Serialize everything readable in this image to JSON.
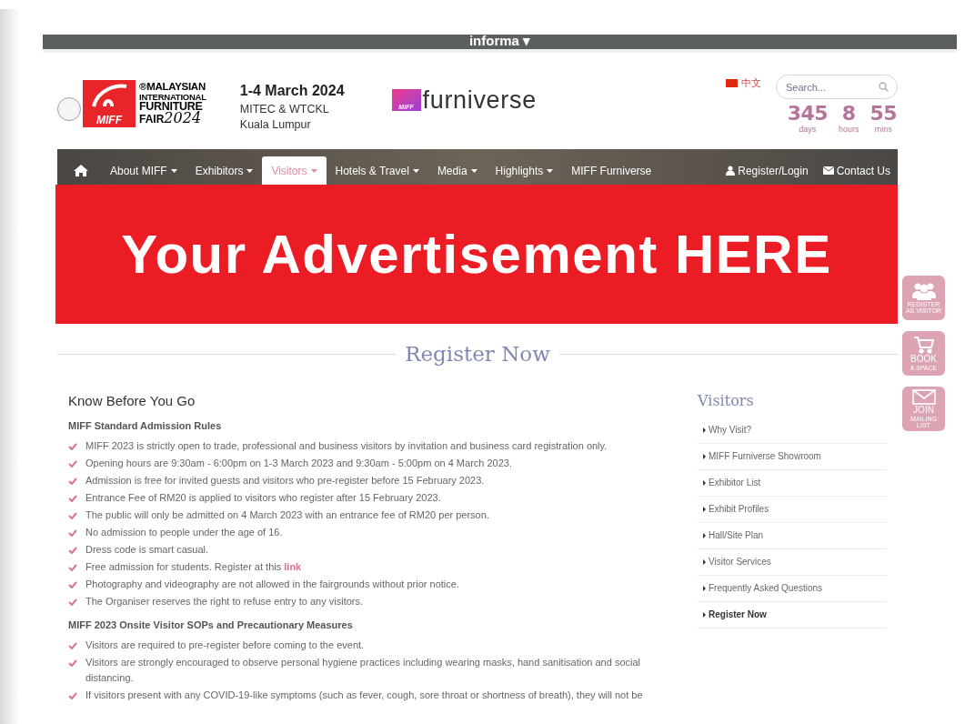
{
  "top_bar": {
    "brand": "informa ▾"
  },
  "header": {
    "logo": {
      "registered": "®",
      "lines": [
        "MALAYSIAN",
        "INTERNATIONAL",
        "FURNITURE"
      ],
      "fair": "FAIR",
      "year": "2024",
      "mark": "MIFF"
    },
    "event": {
      "date": "1-4 March 2024",
      "venue": "MITEC & WTCKL",
      "city": "Kuala Lumpur"
    },
    "partner_logo": {
      "mark": "MIFF",
      "text": "furniverse"
    },
    "language": "中文",
    "search": {
      "placeholder": "Search..."
    },
    "countdown": [
      {
        "value": "345",
        "unit": "days"
      },
      {
        "value": "8",
        "unit": "hours"
      },
      {
        "value": "55",
        "unit": "mins"
      }
    ]
  },
  "nav": {
    "items": [
      {
        "label": "About MIFF",
        "dropdown": true,
        "selected": false
      },
      {
        "label": "Exhibitors",
        "dropdown": true,
        "selected": false
      },
      {
        "label": "Visitors",
        "dropdown": true,
        "selected": true
      },
      {
        "label": "Hotels & Travel",
        "dropdown": true,
        "selected": false
      },
      {
        "label": "Media",
        "dropdown": true,
        "selected": false
      },
      {
        "label": "Highlights",
        "dropdown": true,
        "selected": false
      },
      {
        "label": "MIFF Furniverse",
        "dropdown": false,
        "selected": false
      }
    ],
    "right": [
      {
        "label": "Register/Login",
        "kind": "user"
      },
      {
        "label": "Contact Us",
        "kind": "mail"
      }
    ]
  },
  "banner": {
    "text": "Your Advertisement HERE"
  },
  "section_title": "Register Now",
  "content": {
    "title": "Know Before You Go",
    "groups": [
      {
        "heading": "MIFF Standard Admission Rules",
        "items": [
          {
            "text": "MIFF 2023 is strictly open to trade, professional and business visitors by invitation and business card registration only."
          },
          {
            "text": "Opening hours are 9:30am - 6:00pm on 1-3 March 2023 and 9:30am - 5:00pm on 4 March 2023."
          },
          {
            "text": "Admission is free for invited guests and visitors who pre-register before 15 February 2023."
          },
          {
            "text": "Entrance Fee of RM20 is applied to visitors who register after 15 February 2023."
          },
          {
            "text": "The public will only be admitted on 4 March 2023 with an entrance fee of RM20 per person."
          },
          {
            "text": "No admission to people under the age of 16."
          },
          {
            "text": "Dress code is smart casual."
          },
          {
            "text": "Free admission for students. Register at this",
            "link": "link"
          },
          {
            "text": "Photography and videography are not allowed in the fairgrounds without prior notice."
          },
          {
            "text": "The Organiser reserves the right to refuse entry to any visitors."
          }
        ]
      },
      {
        "heading": "MIFF 2023 Onsite Visitor SOPs and Precautionary Measures",
        "items": [
          {
            "text": "Visitors are required to pre-register before coming to the event."
          },
          {
            "text": "Visitors are strongly encouraged to observe personal hygiene practices including wearing masks, hand sanitisation and social distancing."
          },
          {
            "text": "If visitors present with any COVID-19-like symptoms (such as fever, cough, sore throat or shortness of breath), they will not be"
          }
        ]
      }
    ]
  },
  "sidebar": {
    "title": "Visitors",
    "items": [
      {
        "label": "Why Visit?",
        "selected": false
      },
      {
        "label": "MIFF Furniverse Showroom",
        "selected": false
      },
      {
        "label": "Exhibitor List",
        "selected": false
      },
      {
        "label": "Exhibit Profiles",
        "selected": false
      },
      {
        "label": "Hall/Site Plan",
        "selected": false
      },
      {
        "label": "Visitor Services",
        "selected": false
      },
      {
        "label": "Frequently Asked Questions",
        "selected": false
      },
      {
        "label": "Register Now",
        "selected": true
      }
    ]
  },
  "float_buttons": [
    {
      "kind": "people",
      "small": "REGISTER AS VISITOR"
    },
    {
      "kind": "cart",
      "big": "BOOK",
      "small": "A SPACE"
    },
    {
      "kind": "mail",
      "big": "JOIN",
      "small": "MAILING LIST"
    }
  ]
}
